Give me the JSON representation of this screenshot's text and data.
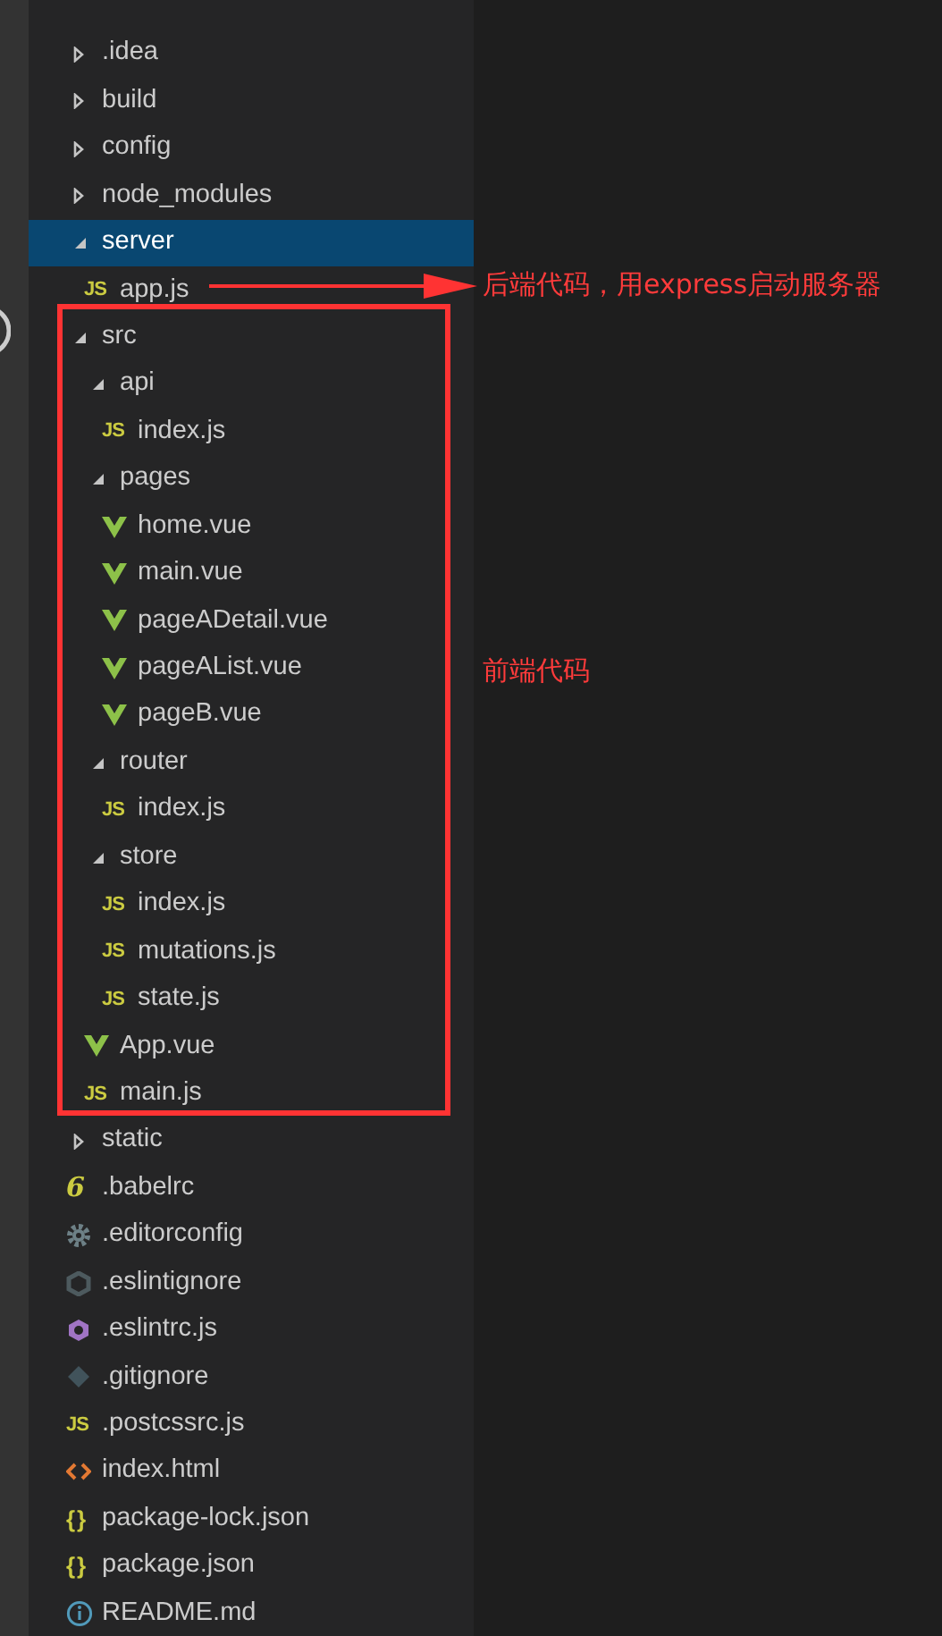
{
  "tree": [
    {
      "kind": "folder",
      "name": ".idea",
      "expanded": false,
      "selected": false
    },
    {
      "kind": "folder",
      "name": "build",
      "expanded": false,
      "selected": false
    },
    {
      "kind": "folder",
      "name": "config",
      "expanded": false,
      "selected": false
    },
    {
      "kind": "folder",
      "name": "node_modules",
      "expanded": false,
      "selected": false
    },
    {
      "kind": "folder",
      "name": "server",
      "expanded": true,
      "selected": true,
      "children": [
        {
          "kind": "js",
          "icon": "JS",
          "name": "app.js",
          "selected": false
        }
      ]
    },
    {
      "kind": "folder",
      "name": "src",
      "expanded": true,
      "selected": false,
      "highlighted": true,
      "children": [
        {
          "kind": "folder",
          "name": "api",
          "expanded": true,
          "selected": false,
          "children": [
            {
              "kind": "js",
              "icon": "JS",
              "name": "index.js",
              "selected": false
            }
          ]
        },
        {
          "kind": "folder",
          "name": "pages",
          "expanded": true,
          "selected": false,
          "children": [
            {
              "kind": "vue",
              "name": "home.vue",
              "selected": false
            },
            {
              "kind": "vue",
              "name": "main.vue",
              "selected": false
            },
            {
              "kind": "vue",
              "name": "pageADetail.vue",
              "selected": false
            },
            {
              "kind": "vue",
              "name": "pageAList.vue",
              "selected": false
            },
            {
              "kind": "vue",
              "name": "pageB.vue",
              "selected": false
            }
          ]
        },
        {
          "kind": "folder",
          "name": "router",
          "expanded": true,
          "selected": false,
          "children": [
            {
              "kind": "js",
              "icon": "JS",
              "name": "index.js",
              "selected": false
            }
          ]
        },
        {
          "kind": "folder",
          "name": "store",
          "expanded": true,
          "selected": false,
          "children": [
            {
              "kind": "js",
              "icon": "JS",
              "name": "index.js",
              "selected": false
            },
            {
              "kind": "js",
              "icon": "JS",
              "name": "mutations.js",
              "selected": false
            },
            {
              "kind": "js",
              "icon": "JS",
              "name": "state.js",
              "selected": false
            }
          ]
        },
        {
          "kind": "vue",
          "name": "App.vue",
          "selected": false
        },
        {
          "kind": "js",
          "icon": "JS",
          "name": "main.js",
          "selected": false
        }
      ]
    },
    {
      "kind": "folder",
      "name": "static",
      "expanded": false,
      "selected": false
    },
    {
      "kind": "babel",
      "icon": "6",
      "name": ".babelrc",
      "selected": false
    },
    {
      "kind": "gear",
      "name": ".editorconfig",
      "selected": false
    },
    {
      "kind": "ignore",
      "name": ".eslintignore",
      "selected": false
    },
    {
      "kind": "eslint",
      "name": ".eslintrc.js",
      "selected": false
    },
    {
      "kind": "git",
      "name": ".gitignore",
      "selected": false
    },
    {
      "kind": "js",
      "icon": "JS",
      "name": ".postcssrc.js",
      "selected": false
    },
    {
      "kind": "html",
      "name": "index.html",
      "selected": false
    },
    {
      "kind": "json",
      "icon": "{}",
      "name": "package-lock.json",
      "selected": false
    },
    {
      "kind": "json",
      "icon": "{}",
      "name": "package.json",
      "selected": false
    },
    {
      "kind": "info",
      "name": "README.md",
      "selected": false
    }
  ],
  "annotations": [
    {
      "kind": "arrow",
      "text": "后端代码，用express启动服务器"
    },
    {
      "kind": "label",
      "text": "前端代码"
    }
  ]
}
